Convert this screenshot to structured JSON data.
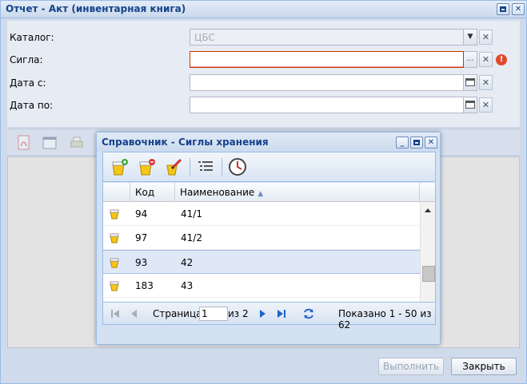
{
  "window": {
    "title": "Отчет - Акт (инвентарная книга)"
  },
  "form": {
    "catalog_label": "Каталог:",
    "catalog_value": "ЦБС",
    "sigla_label": "Сигла:",
    "sigla_value": "",
    "date_from_label": "Дата с:",
    "date_from_value": "",
    "date_to_label": "Дата по:",
    "date_to_value": ""
  },
  "buttons": {
    "execute": "Выполнить",
    "close": "Закрыть"
  },
  "dialog": {
    "title": "Справочник - Сиглы хранения",
    "columns": {
      "code": "Код",
      "name": "Наименование"
    },
    "rows": [
      {
        "code": "94",
        "name": "41/1"
      },
      {
        "code": "97",
        "name": "41/2"
      },
      {
        "code": "93",
        "name": "42"
      },
      {
        "code": "183",
        "name": "43"
      }
    ],
    "pager": {
      "page_label": "Страница",
      "page_value": "1",
      "of_label": "из 2",
      "summary": "Показано 1 - 50 из 62"
    }
  },
  "colors": {
    "accent": "#15428b",
    "error": "#e04a2a",
    "selection": "#dfe8f6"
  }
}
